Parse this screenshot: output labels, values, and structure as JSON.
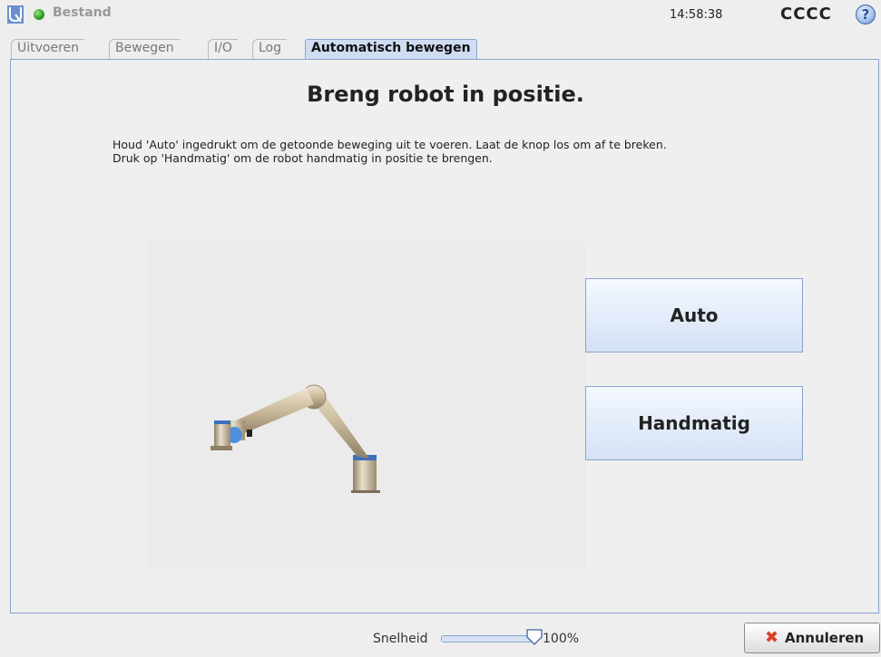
{
  "topbar": {
    "file_menu": "Bestand",
    "clock": "14:58:38",
    "robot_name": "CCCC",
    "help_symbol": "?"
  },
  "tabs": [
    {
      "label": "Uitvoeren",
      "active": false
    },
    {
      "label": "Bewegen",
      "active": false
    },
    {
      "label": "I/O",
      "active": false
    },
    {
      "label": "Log",
      "active": false
    },
    {
      "label": "Automatisch bewegen",
      "active": true
    }
  ],
  "main": {
    "title": "Breng robot in positie.",
    "instruction_line1": "Houd 'Auto' ingedrukt om de getoonde beweging uit te voeren. Laat de knop los om af te breken.",
    "instruction_line2": "Druk op 'Handmatig' om de robot handmatig in positie te brengen.",
    "auto_button": "Auto",
    "manual_button": "Handmatig"
  },
  "bottombar": {
    "speed_label": "Snelheid",
    "speed_value": "100%",
    "speed_fraction": 1.0,
    "cancel_label": "Annuleren",
    "cancel_icon": "close-icon"
  },
  "colors": {
    "accent_border": "#8aa4cf",
    "active_tab_bg": "#cfdcf2",
    "status_ok": "#2fa12a",
    "cancel_red": "#d8402a"
  }
}
